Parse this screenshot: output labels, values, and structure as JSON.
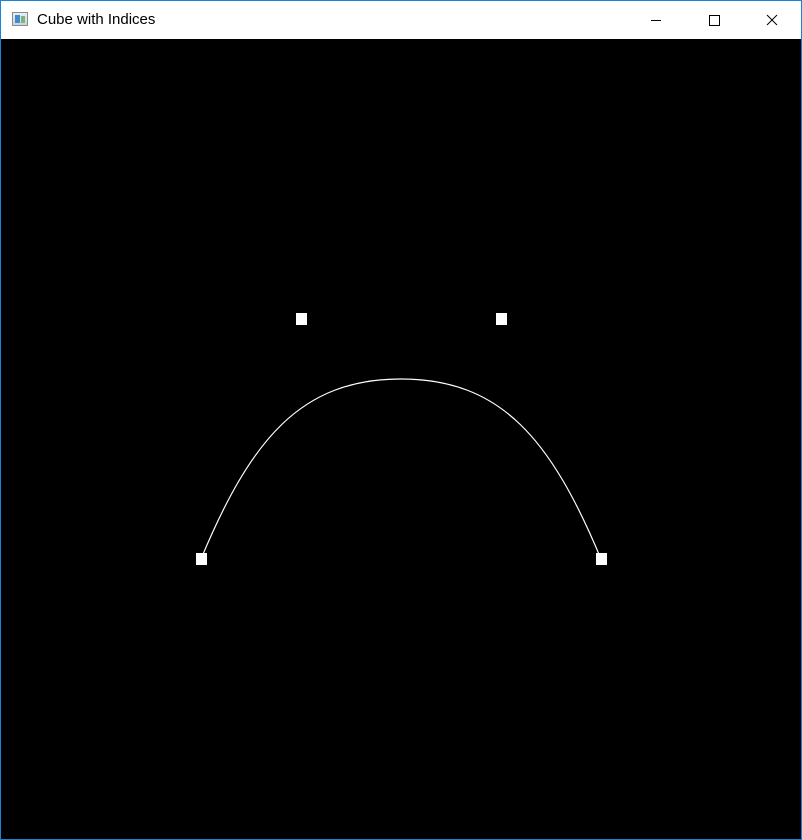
{
  "window": {
    "title": "Cube with Indices",
    "icon": "app-window-icon",
    "controls": [
      {
        "name": "minimize",
        "icon": "minimize-icon"
      },
      {
        "name": "maximize",
        "icon": "maximize-icon"
      },
      {
        "name": "close",
        "icon": "close-icon"
      }
    ]
  },
  "canvas": {
    "background": "#000000",
    "curve_color": "#ffffff",
    "point_color": "#ffffff"
  }
}
